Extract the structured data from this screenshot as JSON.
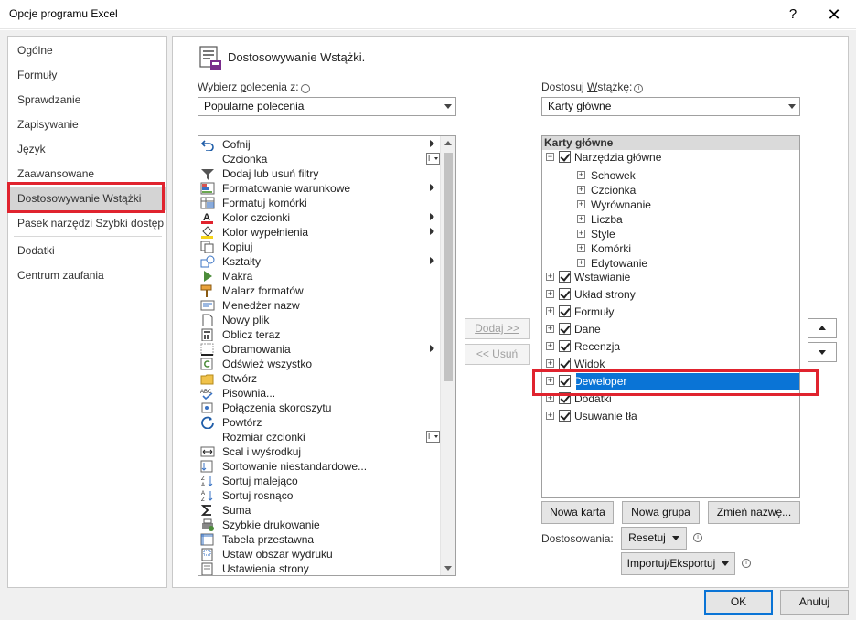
{
  "window": {
    "title": "Opcje programu Excel",
    "help_label": "?",
    "close_label": "✕"
  },
  "nav": {
    "items": [
      {
        "label": "Ogólne",
        "selected": false
      },
      {
        "label": "Formuły",
        "selected": false
      },
      {
        "label": "Sprawdzanie",
        "selected": false
      },
      {
        "label": "Zapisywanie",
        "selected": false
      },
      {
        "label": "Język",
        "selected": false
      },
      {
        "label": "Zaawansowane",
        "selected": false
      },
      {
        "label": "Dostosowywanie Wstążki",
        "selected": true
      },
      {
        "label": "Pasek narzędzi Szybki dostęp",
        "selected": false
      },
      {
        "label": "Dodatki",
        "selected": false
      },
      {
        "label": "Centrum zaufania",
        "selected": false
      }
    ]
  },
  "content": {
    "heading": "Dostosowywanie Wstążki.",
    "choose_label_pre": "Wybierz ",
    "choose_label_u": "p",
    "choose_label_post": "olecenia z:",
    "choose_value": "Popularne polecenia",
    "customize_label_pre": "Dostosuj ",
    "customize_label_u": "W",
    "customize_label_post": "stążkę:",
    "customize_value": "Karty główne",
    "info_glyph": "i"
  },
  "commands": [
    {
      "label": "Cofnij",
      "icon": "undo-icon",
      "sub": true
    },
    {
      "label": "Czcionka",
      "icon": "none",
      "combo": true
    },
    {
      "label": "Dodaj lub usuń filtry",
      "icon": "filter-icon"
    },
    {
      "label": "Formatowanie warunkowe",
      "icon": "conditional-format-icon",
      "sub": true
    },
    {
      "label": "Formatuj komórki",
      "icon": "format-cells-icon"
    },
    {
      "label": "Kolor czcionki",
      "icon": "font-color-icon",
      "sub": true
    },
    {
      "label": "Kolor wypełnienia",
      "icon": "fill-color-icon",
      "sub": true
    },
    {
      "label": "Kopiuj",
      "icon": "copy-icon"
    },
    {
      "label": "Kształty",
      "icon": "shapes-icon",
      "sub": true
    },
    {
      "label": "Makra",
      "icon": "macro-icon"
    },
    {
      "label": "Malarz formatów",
      "icon": "format-painter-icon"
    },
    {
      "label": "Menedżer nazw",
      "icon": "name-manager-icon"
    },
    {
      "label": "Nowy plik",
      "icon": "new-file-icon"
    },
    {
      "label": "Oblicz teraz",
      "icon": "calculator-icon"
    },
    {
      "label": "Obramowania",
      "icon": "borders-icon",
      "sub": true
    },
    {
      "label": "Odśwież wszystko",
      "icon": "refresh-icon"
    },
    {
      "label": "Otwórz",
      "icon": "folder-icon"
    },
    {
      "label": "Pisownia...",
      "icon": "spelling-icon"
    },
    {
      "label": "Połączenia skoroszytu",
      "icon": "connections-icon"
    },
    {
      "label": "Powtórz",
      "icon": "redo-icon"
    },
    {
      "label": "Rozmiar czcionki",
      "icon": "none",
      "combo": true
    },
    {
      "label": "Scal i wyśrodkuj",
      "icon": "merge-center-icon"
    },
    {
      "label": "Sortowanie niestandardowe...",
      "icon": "custom-sort-icon"
    },
    {
      "label": "Sortuj malejąco",
      "icon": "sort-desc-icon"
    },
    {
      "label": "Sortuj rosnąco",
      "icon": "sort-asc-icon"
    },
    {
      "label": "Suma",
      "icon": "sum-icon"
    },
    {
      "label": "Szybkie drukowanie",
      "icon": "quick-print-icon"
    },
    {
      "label": "Tabela przestawna",
      "icon": "pivot-table-icon"
    },
    {
      "label": "Ustaw obszar wydruku",
      "icon": "print-area-icon"
    },
    {
      "label": "Ustawienia strony",
      "icon": "page-setup-icon"
    }
  ],
  "middle": {
    "add_label": "Dodaj >>",
    "remove_label": "<< Usuń"
  },
  "tree": {
    "header": "Karty główne",
    "root": "Narzędzia główne",
    "groups": [
      "Schowek",
      "Czcionka",
      "Wyrównanie",
      "Liczba",
      "Style",
      "Komórki",
      "Edytowanie"
    ],
    "tabs": [
      {
        "label": "Wstawianie"
      },
      {
        "label": "Układ strony"
      },
      {
        "label": "Formuły"
      },
      {
        "label": "Dane"
      },
      {
        "label": "Recenzja"
      },
      {
        "label": "Widok"
      },
      {
        "label": "Deweloper",
        "selected": true
      },
      {
        "label": "Dodatki"
      },
      {
        "label": "Usuwanie tła"
      }
    ],
    "expand_glyph": "+",
    "collapse_glyph": "−"
  },
  "buttons": {
    "new_tab": "Nowa karta",
    "new_group": "Nowa grupa",
    "rename": "Zmień nazwę...",
    "customizations_label": "Dostosowania:",
    "reset": "Resetuj",
    "import_export": "Importuj/Eksportuj",
    "ok": "OK",
    "cancel": "Anuluj"
  },
  "colors": {
    "selection_blue": "#0a74d6",
    "highlight_red": "#e0232e"
  }
}
